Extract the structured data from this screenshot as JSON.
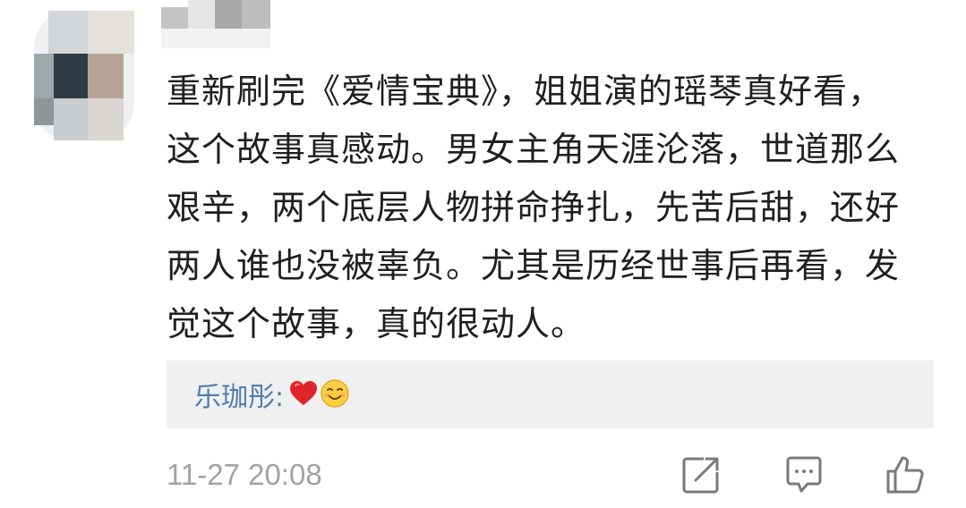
{
  "comment": {
    "lines": [
      "重新刷完《爱情宝典》，姐姐演的瑶琴真好看，",
      "这个故事真感动。男女主角天涯沦落，世道那么",
      "艰辛，两个底层人物拼命挣扎，先苦后甜，还好",
      "两人谁也没被辜负。尤其是历经世事后再看，发",
      "觉这个故事，真的很动人。"
    ],
    "reply": {
      "author": "乐珈彤",
      "colon": ":",
      "emojis": [
        "heart-icon",
        "smiling-face-icon"
      ]
    },
    "timestamp": "11-27 20:08"
  },
  "actions": [
    "share-icon",
    "comment-icon",
    "like-icon"
  ],
  "colors": {
    "text": "#1f1f1f",
    "link": "#507daf",
    "meta": "#a2a2a2",
    "reply_bg": "#f0f0f0",
    "heart": "#e0242b"
  }
}
